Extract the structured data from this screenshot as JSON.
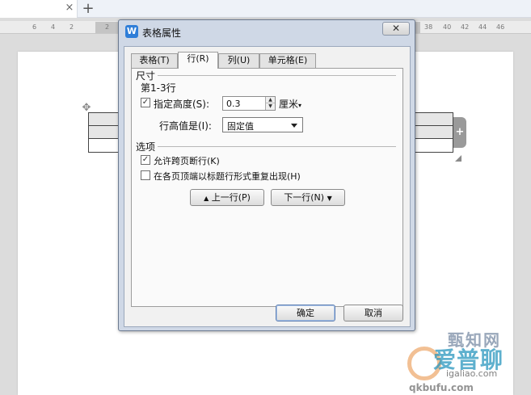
{
  "browser": {
    "tab_close": "×",
    "new_tab": "+"
  },
  "ruler": {
    "left_marks": [
      "6",
      "4",
      "2",
      "2"
    ],
    "right_marks": [
      "38",
      "40",
      "42",
      "44",
      "46"
    ]
  },
  "dialog": {
    "title": "表格属性",
    "close_label": "✕",
    "tabs": [
      {
        "label": "表格(T)",
        "active": false
      },
      {
        "label": "行(R)",
        "active": true
      },
      {
        "label": "列(U)",
        "active": false
      },
      {
        "label": "单元格(E)",
        "active": false
      }
    ],
    "size_group": {
      "title": "尺寸",
      "rows_label": "第1-3行",
      "specify_height": {
        "label": "指定高度(S):",
        "checked": true,
        "value": "0.3",
        "unit": "厘米"
      },
      "height_rule": {
        "label": "行高值是(I):",
        "selected": "固定值"
      }
    },
    "options_group": {
      "title": "选项",
      "allow_break": {
        "label": "允许跨页断行(K)",
        "checked": true
      },
      "repeat_header": {
        "label": "在各页顶端以标题行形式重复出现(H)",
        "checked": false
      }
    },
    "nav": {
      "prev_label": "上一行(P)",
      "next_label": "下一行(N)"
    },
    "footer": {
      "ok_label": "确定",
      "cancel_label": "取消"
    }
  },
  "document": {
    "move_handle": "✥",
    "add_row": "+"
  },
  "watermark": {
    "line1": "甄知网",
    "line2": "爱普聊",
    "url1": "igaliao.com",
    "url2": "qkbufu.com"
  },
  "colors": {
    "dialog_frame": "#cfd8e6",
    "app_logo": "#2f7ed8",
    "accent_button_border": "#5e7fb2"
  }
}
